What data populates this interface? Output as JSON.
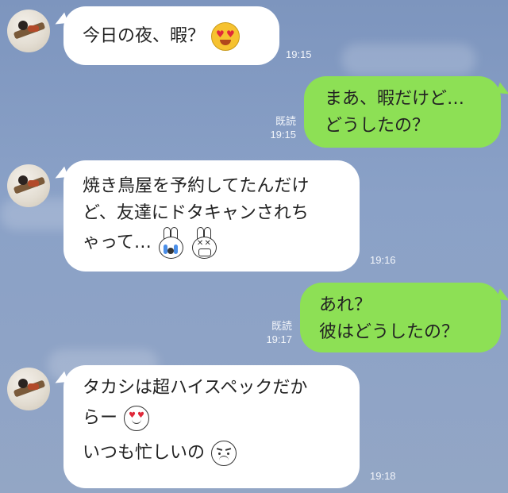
{
  "messages": [
    {
      "lines": [
        "今日の夜、暇？"
      ],
      "time": "19:15"
    },
    {
      "lines": [
        "まあ、暇だけど…",
        "どうしたの？"
      ],
      "read": "既読",
      "time": "19:15"
    },
    {
      "lines": [
        "焼き鳥屋を予約してたんだけ",
        "ど、友達にドタキャンされち",
        "ゃって…"
      ],
      "time": "19:16"
    },
    {
      "lines": [
        "あれ？",
        "彼はどうしたの？"
      ],
      "read": "既読",
      "time": "19:17"
    },
    {
      "lines": [
        "タカシは超ハイスペックだか",
        "らー",
        "いつも忙しいの"
      ],
      "time": "19:18"
    }
  ],
  "emoji": {
    "m1": "heart-eyes-face-icon",
    "m3a": "crying-bunny-icon",
    "m3b": "shocked-bunny-icon",
    "m5a": "heart-eyes-outline-face-icon",
    "m5b": "frowning-face-icon"
  },
  "colors": {
    "incoming": "#ffffff",
    "outgoing": "#8de055",
    "background": "#8aa1c7"
  }
}
